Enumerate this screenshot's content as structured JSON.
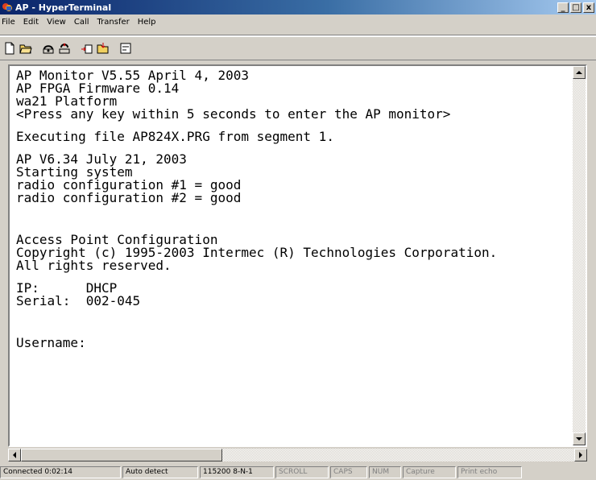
{
  "window": {
    "title": "AP - HyperTerminal",
    "minimize": "_",
    "maximize": "□",
    "close": "x"
  },
  "menu": [
    "File",
    "Edit",
    "View",
    "Call",
    "Transfer",
    "Help"
  ],
  "toolbar": {
    "icons": [
      "new-icon",
      "open-icon",
      "connect-icon",
      "disconnect-icon",
      "send-icon",
      "receive-icon",
      "properties-icon"
    ]
  },
  "terminal": {
    "lines": [
      "AP Monitor V5.55 April 4, 2003",
      "AP FPGA Firmware 0.14",
      "wa21 Platform",
      "<Press any key within 5 seconds to enter the AP monitor>",
      "",
      "Executing file AP824X.PRG from segment 1.",
      "",
      "AP V6.34 July 21, 2003",
      "Starting system",
      "radio configuration #1 = good",
      "radio configuration #2 = good",
      "",
      "",
      "",
      "Access Point Configuration",
      "Copyright (c) 1995-2003 Intermec (R) Technologies Corporation.",
      "All rights reserved.",
      "",
      "IP:      DHCP",
      "Serial:  002-045",
      "",
      "",
      "",
      "Username:"
    ]
  },
  "status": {
    "connected": "Connected 0:02:14",
    "detect": "Auto detect",
    "settings": "115200 8-N-1",
    "scroll": "SCROLL",
    "caps": "CAPS",
    "num": "NUM",
    "capture": "Capture",
    "print_echo": "Print echo"
  }
}
